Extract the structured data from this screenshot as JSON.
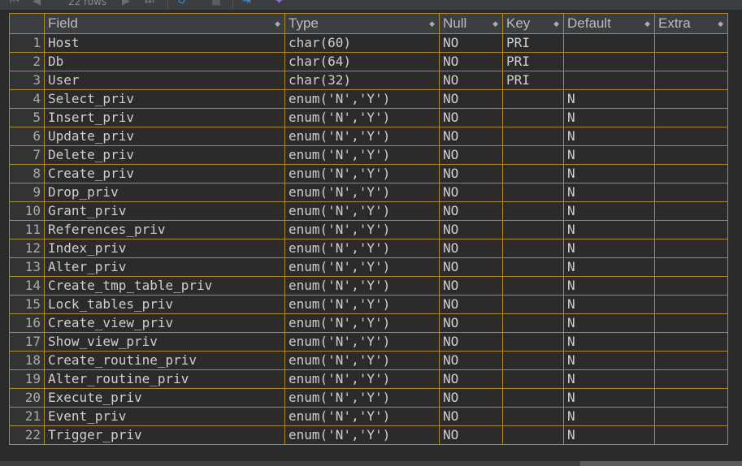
{
  "toolbar": {
    "rows_label": "22 rows"
  },
  "columns": [
    {
      "label": "Field"
    },
    {
      "label": "Type"
    },
    {
      "label": "Null"
    },
    {
      "label": "Key"
    },
    {
      "label": "Default"
    },
    {
      "label": "Extra"
    }
  ],
  "rows": [
    {
      "n": "1",
      "field": "Host",
      "type": "char(60)",
      "null": "NO",
      "key": "PRI",
      "default": "",
      "extra": ""
    },
    {
      "n": "2",
      "field": "Db",
      "type": "char(64)",
      "null": "NO",
      "key": "PRI",
      "default": "",
      "extra": ""
    },
    {
      "n": "3",
      "field": "User",
      "type": "char(32)",
      "null": "NO",
      "key": "PRI",
      "default": "",
      "extra": ""
    },
    {
      "n": "4",
      "field": "Select_priv",
      "type": "enum('N','Y')",
      "null": "NO",
      "key": "",
      "default": "N",
      "extra": ""
    },
    {
      "n": "5",
      "field": "Insert_priv",
      "type": "enum('N','Y')",
      "null": "NO",
      "key": "",
      "default": "N",
      "extra": ""
    },
    {
      "n": "6",
      "field": "Update_priv",
      "type": "enum('N','Y')",
      "null": "NO",
      "key": "",
      "default": "N",
      "extra": ""
    },
    {
      "n": "7",
      "field": "Delete_priv",
      "type": "enum('N','Y')",
      "null": "NO",
      "key": "",
      "default": "N",
      "extra": ""
    },
    {
      "n": "8",
      "field": "Create_priv",
      "type": "enum('N','Y')",
      "null": "NO",
      "key": "",
      "default": "N",
      "extra": ""
    },
    {
      "n": "9",
      "field": "Drop_priv",
      "type": "enum('N','Y')",
      "null": "NO",
      "key": "",
      "default": "N",
      "extra": ""
    },
    {
      "n": "10",
      "field": "Grant_priv",
      "type": "enum('N','Y')",
      "null": "NO",
      "key": "",
      "default": "N",
      "extra": ""
    },
    {
      "n": "11",
      "field": "References_priv",
      "type": "enum('N','Y')",
      "null": "NO",
      "key": "",
      "default": "N",
      "extra": ""
    },
    {
      "n": "12",
      "field": "Index_priv",
      "type": "enum('N','Y')",
      "null": "NO",
      "key": "",
      "default": "N",
      "extra": ""
    },
    {
      "n": "13",
      "field": "Alter_priv",
      "type": "enum('N','Y')",
      "null": "NO",
      "key": "",
      "default": "N",
      "extra": ""
    },
    {
      "n": "14",
      "field": "Create_tmp_table_priv",
      "type": "enum('N','Y')",
      "null": "NO",
      "key": "",
      "default": "N",
      "extra": ""
    },
    {
      "n": "15",
      "field": "Lock_tables_priv",
      "type": "enum('N','Y')",
      "null": "NO",
      "key": "",
      "default": "N",
      "extra": ""
    },
    {
      "n": "16",
      "field": "Create_view_priv",
      "type": "enum('N','Y')",
      "null": "NO",
      "key": "",
      "default": "N",
      "extra": ""
    },
    {
      "n": "17",
      "field": "Show_view_priv",
      "type": "enum('N','Y')",
      "null": "NO",
      "key": "",
      "default": "N",
      "extra": ""
    },
    {
      "n": "18",
      "field": "Create_routine_priv",
      "type": "enum('N','Y')",
      "null": "NO",
      "key": "",
      "default": "N",
      "extra": ""
    },
    {
      "n": "19",
      "field": "Alter_routine_priv",
      "type": "enum('N','Y')",
      "null": "NO",
      "key": "",
      "default": "N",
      "extra": ""
    },
    {
      "n": "20",
      "field": "Execute_priv",
      "type": "enum('N','Y')",
      "null": "NO",
      "key": "",
      "default": "N",
      "extra": ""
    },
    {
      "n": "21",
      "field": "Event_priv",
      "type": "enum('N','Y')",
      "null": "NO",
      "key": "",
      "default": "N",
      "extra": ""
    },
    {
      "n": "22",
      "field": "Trigger_priv",
      "type": "enum('N','Y')",
      "null": "NO",
      "key": "",
      "default": "N",
      "extra": ""
    }
  ],
  "colors": {
    "background": "#2b2b2b",
    "header": "#3c3f41",
    "grid_border": "#b08a2a",
    "text": "#cfcfcf"
  }
}
